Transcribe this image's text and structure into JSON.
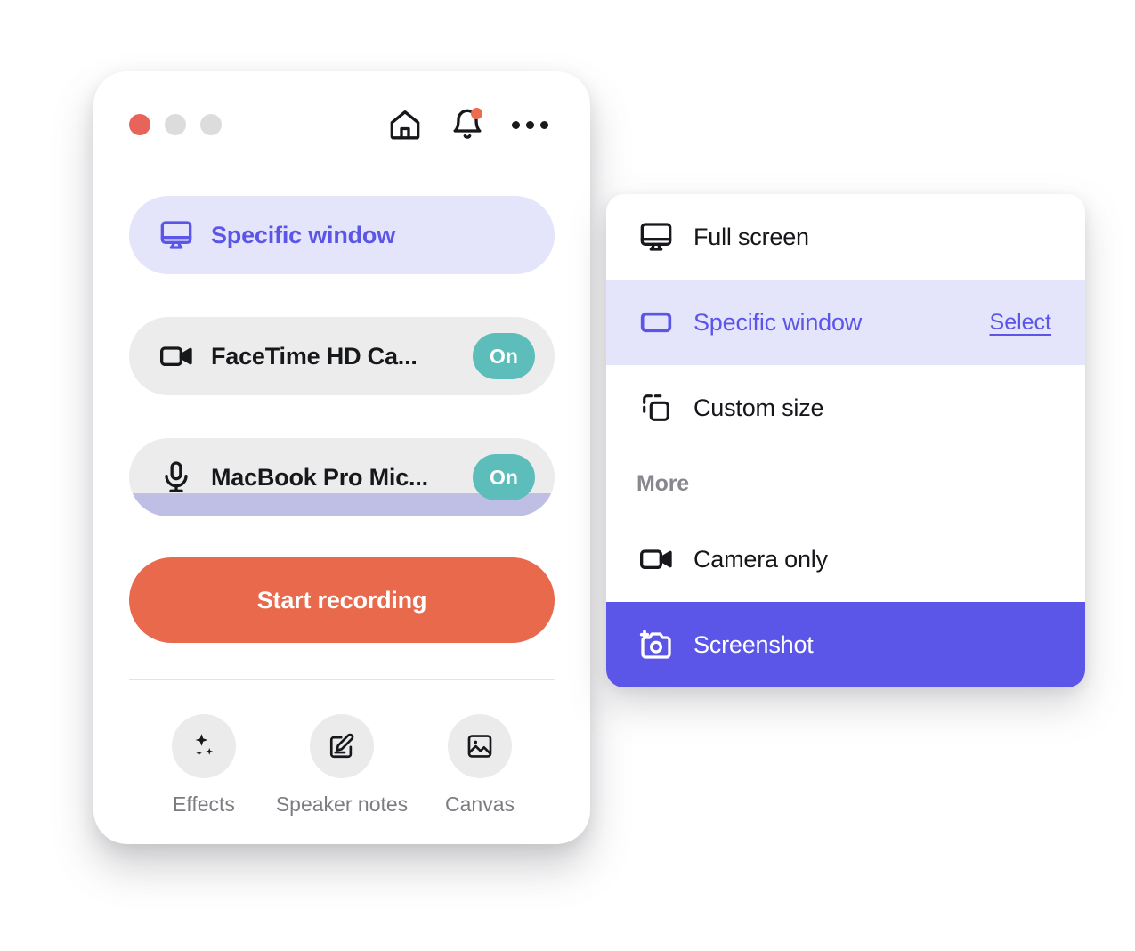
{
  "recorder": {
    "titlebar": {
      "traffic_lights": [
        {
          "name": "close",
          "color": "#E8645A"
        },
        {
          "name": "minimize",
          "color": "#DCDCDC"
        },
        {
          "name": "zoom",
          "color": "#DCDCDC"
        }
      ],
      "actions": [
        {
          "id": "home",
          "icon": "home-icon"
        },
        {
          "id": "notifications",
          "icon": "bell-icon",
          "badge": true,
          "badge_color": "#ED6B4E"
        },
        {
          "id": "more",
          "icon": "more-horizontal-icon"
        }
      ]
    },
    "sources": [
      {
        "id": "screen",
        "icon": "monitor-icon",
        "label": "Specific window",
        "state": "active",
        "toggle": null,
        "audio_level": false
      },
      {
        "id": "camera",
        "icon": "video-camera-icon",
        "label": "FaceTime HD Ca...",
        "state": "plain",
        "toggle": "On",
        "audio_level": false
      },
      {
        "id": "microphone",
        "icon": "microphone-icon",
        "label": "MacBook Pro Mic...",
        "state": "plain",
        "toggle": "On",
        "audio_level": true
      }
    ],
    "primary_button": {
      "label": "Start recording",
      "color": "#E8694C"
    },
    "tools": [
      {
        "id": "effects",
        "icon": "sparkle-icon",
        "label": "Effects"
      },
      {
        "id": "speaker-notes",
        "icon": "edit-square-icon",
        "label": "Speaker notes"
      },
      {
        "id": "canvas",
        "icon": "image-icon",
        "label": "Canvas"
      }
    ]
  },
  "dropdown": {
    "items": [
      {
        "id": "full-screen",
        "icon": "monitor-icon",
        "label": "Full screen",
        "highlight": "none",
        "action": null
      },
      {
        "id": "specific-window",
        "icon": "window-icon",
        "label": "Specific window",
        "highlight": "soft",
        "action": "Select"
      },
      {
        "id": "custom-size",
        "icon": "copy-icon",
        "label": "Custom size",
        "highlight": "none",
        "action": null
      }
    ],
    "section_label": "More",
    "more_items": [
      {
        "id": "camera-only",
        "icon": "video-camera-icon",
        "label": "Camera only",
        "highlight": "none",
        "action": null
      },
      {
        "id": "screenshot",
        "icon": "camera-plus-icon",
        "label": "Screenshot",
        "highlight": "solid",
        "action": null
      }
    ]
  },
  "colors": {
    "accent_purple": "#5B55E8",
    "accent_purple_soft": "#E4E4FB",
    "accent_orange": "#E8694C",
    "accent_teal": "#5DBDBB",
    "audio_level_purple": "#BFBEE4",
    "row_gray": "#ECECEC"
  }
}
